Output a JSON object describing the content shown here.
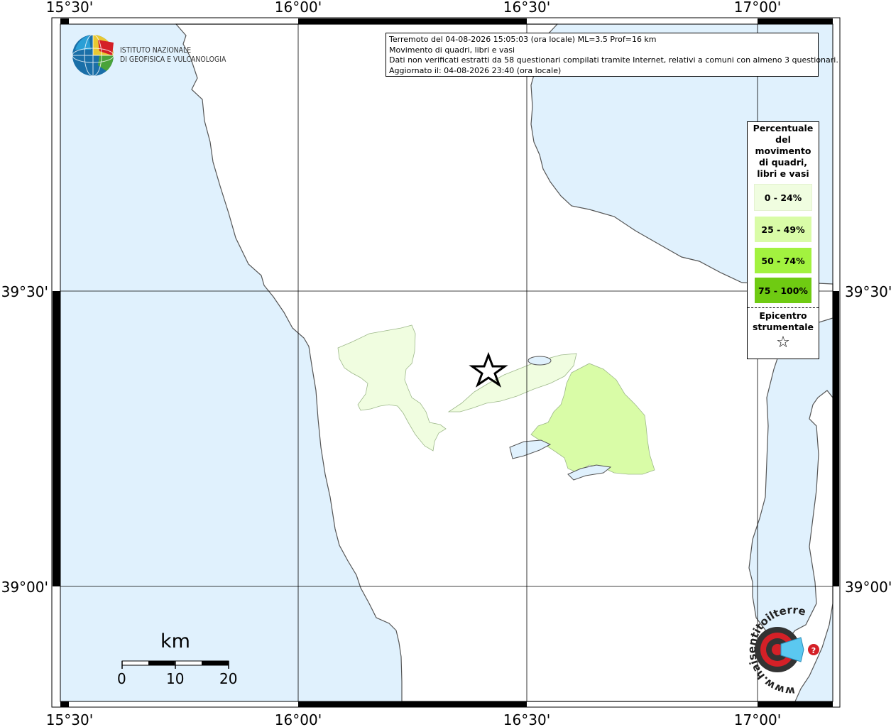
{
  "map": {
    "lon_labels": [
      "15°30'",
      "16°00'",
      "16°30'",
      "17°00'"
    ],
    "lat_labels": [
      "39°30'",
      "39°00'"
    ],
    "colors": {
      "sea": "#e0f1fd",
      "land": "#ffffff",
      "coast": "#555555",
      "grid": "#000000"
    }
  },
  "logo": {
    "line1": "ISTITUTO NAZIONALE",
    "line2": "DI GEOFISICA E VULCANOLOGIA",
    "icon": "ingv-globe-icon"
  },
  "info": {
    "line1": "Terremoto del 04-08-2026 15:05:03 (ora locale) ML=3.5 Prof=16 km",
    "line2": "Movimento di quadri, libri e vasi",
    "line3": "Dati non verificati estratti da 58 questionari compilati tramite Internet, relativi a comuni con almeno 3 questionari.",
    "line4": "Aggiornato il: 04-08-2026 23:40 (ora locale)"
  },
  "legend": {
    "title": "Percentuale del movimento di quadri, libri e vasi",
    "items": [
      {
        "label": "0 - 24%",
        "color": "#f0fde0"
      },
      {
        "label": "25 - 49%",
        "color": "#d9fca7"
      },
      {
        "label": "50 - 74%",
        "color": "#a2f23f"
      },
      {
        "label": "75 - 100%",
        "color": "#6fcb12"
      }
    ],
    "epicenter_title": "Epicentro strumentale",
    "epicenter_symbol": "☆"
  },
  "scale": {
    "unit": "km",
    "ticks": [
      "0",
      "10",
      "20"
    ]
  },
  "watermark": {
    "text": "www.haisentitoilterremoto.it",
    "icon": "megaphone-logo-icon"
  }
}
